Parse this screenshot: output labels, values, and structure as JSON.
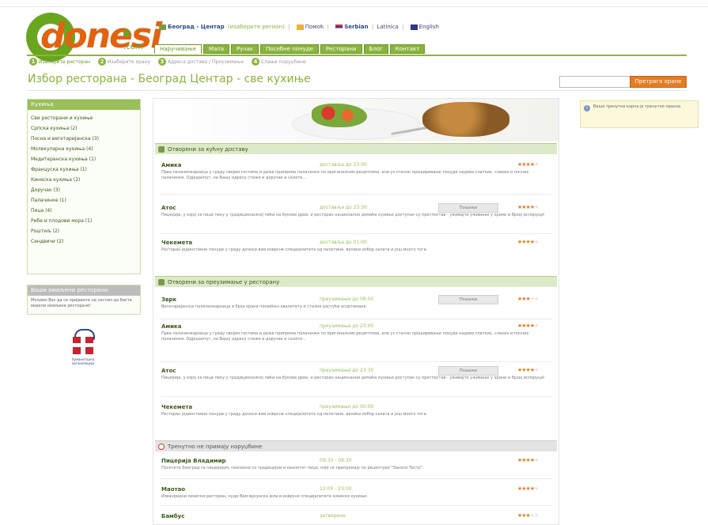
{
  "logo": {
    "text": "donesi",
    "suffix": ".com"
  },
  "toplinks": {
    "city": "Београд - Центар",
    "change_city": "(изаберите регион)",
    "help": "Помоћ",
    "serbian": "Serbian",
    "latinica": "Latinica",
    "english": "English"
  },
  "nav": {
    "tabs": [
      "Наручивање",
      "Мапа",
      "Ручак",
      "Посебне понуде",
      "Ресторани",
      "Блог",
      "Контакт"
    ],
    "active_index": 0
  },
  "steps": [
    {
      "num": "1",
      "label": "Изаберите ресторан"
    },
    {
      "num": "2",
      "label": "Изаберите храну"
    },
    {
      "num": "3",
      "label": "Адреса доставе / Преузимање"
    },
    {
      "num": "4",
      "label": "Слање поруџбине"
    }
  ],
  "page_title": "Избор ресторана - Београд Центар - све кухиње",
  "search": {
    "placeholder": "",
    "button": "Претрага хране"
  },
  "sidebar": {
    "cuisines_title": "Кухиња",
    "cuisines": [
      "Сви ресторани и кухиње",
      "Српска кухиња (2)",
      "Посна и вегетаријанска (3)",
      "Молекуларна кухиња (4)",
      "Медитеранска кухиња (1)",
      "Француска кухиња (1)",
      "Кинеска кухиња (2)",
      "Доручак (3)",
      "Палачинке (1)",
      "Пица (4)",
      "Рибе и плодови мора (1)",
      "Роштиљ (2)",
      "Сендвичи (2)"
    ],
    "favorites_title": "Ваши омиљени ресторани",
    "favorites_text": "Молимо Вас да се пријавите на систем да бисте видели омиљене ресторане!",
    "gift_caption": "Хуманитарна организација"
  },
  "info_box": "Ваша тренутна корпа је тренутно празна.",
  "sections": [
    {
      "title": "Отворени за кућну доставу",
      "style": "green",
      "restaurants": [
        {
          "name": "Амика",
          "status": "доставља до 23:00",
          "button": "",
          "stars": 4,
          "desc": "Прва палачинкарница у граду својим гостима и даље припрема палачинке по оригиналним рецептима, али уз стално проширивање понуде надева слатких, сланих и посних палачинки. Одједанпут, на Вашу адресу стиже и доручак и салате..."
        },
        {
          "name": "Атос",
          "status": "доставља до 23:30",
          "button": "Пошаљи",
          "stars": 4,
          "desc": "Пицерија, у којој се пице пеку у традиционалној пећи на букова дрва, и ресторан националне домаће кухиње доступан су претпостав - уживајте уживање у храни и брзој испоруци!"
        },
        {
          "name": "Чекеметa",
          "status": "доставља до 01:00",
          "button": "",
          "stars": 4,
          "desc": "Ресторан јединствене понуде у граду доноси вам изврсне специјалитете од пилетине, велики избор салата и још много тога."
        }
      ]
    },
    {
      "title": "Отворени за преузимање у ресторану",
      "style": "green",
      "restaurants": [
        {
          "name": "Зврк",
          "status": "преузимање до 08:00",
          "button": "Пошаљи",
          "stars": 3,
          "desc": "Вегетаријанска палачинкарница и брза храна посвећен квалитету и сталне растући асортимана."
        },
        {
          "name": "Амика",
          "status": "преузимање до 23:00",
          "button": "",
          "stars": 4,
          "desc": "Прва палачинкарница у граду својим гостима и даље припрема палачинке по оригиналним рецептима, али уз стално проширивање понуде надева слатких, сланих и посних палачинки. Одједанпут, на Вашу адресу стиже и доручак и салате..."
        },
        {
          "name": "Атос",
          "status": "преузимање до 23:30",
          "button": "Пошаљи",
          "stars": 4,
          "desc": "Пицерија, у којој се пице пеку у традиционалној пећи на букова дрва, и ресторан националне домаће кухиње доступан су претпостав - уживајте уживање у храни и брзој испоруци!"
        },
        {
          "name": "Чекеметa",
          "status": "преузимање до 00:00",
          "button": "",
          "stars": 4,
          "desc": "Ресторан јединствене понуде у граду доноси вам изврсне специјалитете од пилетине, велики избор салата и још много тога."
        }
      ]
    },
    {
      "title": "Тренутно не примају наруџбине",
      "style": "gray",
      "restaurants": [
        {
          "name": "Пицерија Владимир",
          "status": "09:30 - 08:30",
          "button": "",
          "stars": 4,
          "desc": "Посетите Београд са пицеријом, сенсиони со традицијом и квалитет пица, које се припремају по рецептури \"Заноси Тесто\"."
        },
        {
          "name": "Маотао",
          "status": "12:00 - 23:00",
          "button": "",
          "stars": 4,
          "desc": "Изванредни кинески ресторан, нуди Вам врхунска јела и изврсне специјалитете кинеске кухиње."
        },
        {
          "name": "Бамбус",
          "status": "затворено",
          "button": "",
          "stars": 3,
          "desc": ""
        }
      ]
    }
  ]
}
